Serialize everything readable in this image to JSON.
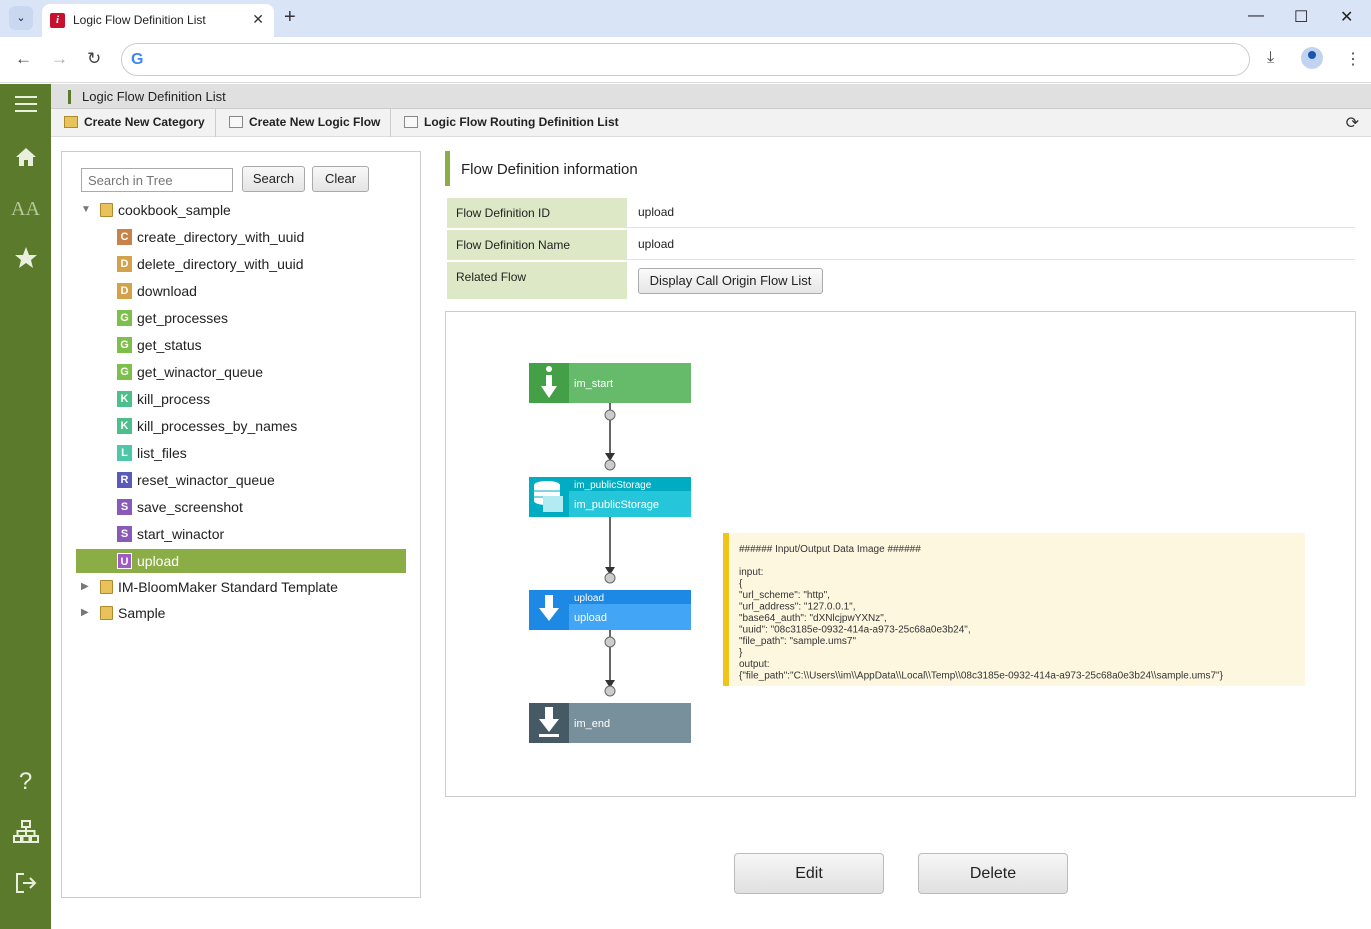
{
  "browser": {
    "tab_title": "Logic Flow Definition List",
    "tab_close": "✕",
    "new_tab": "+",
    "omnibox_logo": "G",
    "window_controls": [
      "—",
      "☐",
      "✕"
    ]
  },
  "app": {
    "title": "Logic Flow Definition List",
    "toolbar": {
      "create_category": "Create New Category",
      "create_flow": "Create New Logic Flow",
      "routing_list": "Logic Flow Routing Definition List"
    },
    "colors": {
      "sidebar": "#5b7a2c",
      "accent": "#8aad45",
      "label_bg": "#dde9c6"
    }
  },
  "tree": {
    "search_placeholder": "Search in Tree",
    "search_label": "Search",
    "clear_label": "Clear",
    "root": "cookbook_sample",
    "items": [
      {
        "badge": "C",
        "label": "create_directory_with_uuid",
        "color": "#c8834a"
      },
      {
        "badge": "D",
        "label": "delete_directory_with_uuid",
        "color": "#d4a24a"
      },
      {
        "badge": "D",
        "label": "download",
        "color": "#d4a24a"
      },
      {
        "badge": "G",
        "label": "get_processes",
        "color": "#7cbf4a"
      },
      {
        "badge": "G",
        "label": "get_status",
        "color": "#7cbf4a"
      },
      {
        "badge": "G",
        "label": "get_winactor_queue",
        "color": "#7cbf4a"
      },
      {
        "badge": "K",
        "label": "kill_process",
        "color": "#4cbf8a"
      },
      {
        "badge": "K",
        "label": "kill_processes_by_names",
        "color": "#4cbf8a"
      },
      {
        "badge": "L",
        "label": "list_files",
        "color": "#4cc8a8"
      },
      {
        "badge": "R",
        "label": "reset_winactor_queue",
        "color": "#5a5ab8"
      },
      {
        "badge": "S",
        "label": "save_screenshot",
        "color": "#8a5ab8"
      },
      {
        "badge": "S",
        "label": "start_winactor",
        "color": "#8a5ab8"
      },
      {
        "badge": "U",
        "label": "upload",
        "color": "#a05ac8"
      }
    ],
    "other_folders": [
      "IM-BloomMaker Standard Template",
      "Sample"
    ]
  },
  "info": {
    "heading": "Flow Definition information",
    "id_label": "Flow Definition ID",
    "id_value": "upload",
    "name_label": "Flow Definition Name",
    "name_value": "upload",
    "related_label": "Related Flow",
    "related_button": "Display Call Origin Flow List"
  },
  "diagram": {
    "nodes": [
      {
        "title": "im_start",
        "subtitle": ""
      },
      {
        "title": "im_publicStorage",
        "subtitle": "im_publicStorage"
      },
      {
        "title": "upload",
        "subtitle": "upload"
      },
      {
        "title": "im_end",
        "subtitle": ""
      }
    ],
    "note_lines": [
      "###### Input/Output Data Image ######",
      "",
      "input:",
      "{",
      " \"url_scheme\": \"http\",",
      " \"url_address\": \"127.0.0.1\",",
      " \"base64_auth\": \"dXNlcjpwYXNz\",",
      " \"uuid\": \"08c3185e-0932-414a-a973-25c68a0e3b24\",",
      " \"file_path\": \"sample.ums7\"",
      "}",
      "output:",
      "{\"file_path\":\"C:\\\\Users\\\\im\\\\AppData\\\\Local\\\\Temp\\\\08c3185e-0932-414a-a973-25c68a0e3b24\\\\sample.ums7\"}"
    ]
  },
  "actions": {
    "edit": "Edit",
    "delete": "Delete"
  }
}
